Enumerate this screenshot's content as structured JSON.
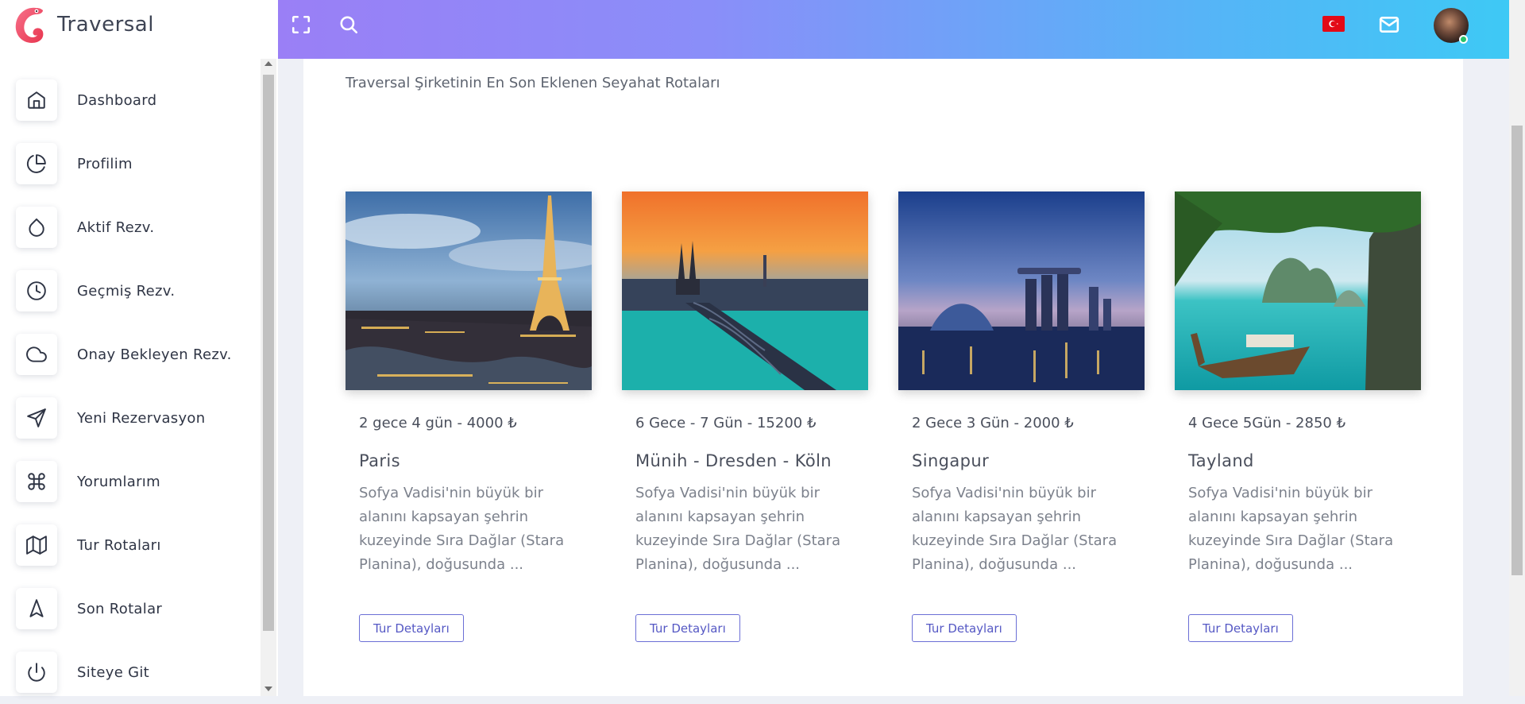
{
  "app": {
    "logo_text": "Traversal"
  },
  "sidebar": {
    "items": [
      {
        "label": "Dashboard",
        "icon": "home-icon"
      },
      {
        "label": "Profilim",
        "icon": "pie-chart-icon"
      },
      {
        "label": "Aktif Rezv.",
        "icon": "droplet-icon"
      },
      {
        "label": "Geçmiş Rezv.",
        "icon": "clock-icon"
      },
      {
        "label": "Onay Bekleyen Rezv.",
        "icon": "cloud-icon"
      },
      {
        "label": "Yeni Rezervasyon",
        "icon": "send-icon"
      },
      {
        "label": "Yorumlarım",
        "icon": "command-icon"
      },
      {
        "label": "Tur Rotaları",
        "icon": "map-icon"
      },
      {
        "label": "Son Rotalar",
        "icon": "navigation-icon"
      },
      {
        "label": "Siteye Git",
        "icon": "power-icon"
      }
    ]
  },
  "topbar": {
    "icons": [
      "fullscreen-icon",
      "search-icon",
      "turkey-flag-icon",
      "mail-icon",
      "user-avatar"
    ]
  },
  "main": {
    "subtitle": "Traversal Şirketinin En Son Eklenen Seyahat Rotaları",
    "tours": [
      {
        "meta": "2 gece 4 gün - 4000 ₺",
        "title": "Paris",
        "description": "Sofya Vadisi'nin büyük bir alanını kapsayan şehrin kuzeyinde Sıra Dağlar (Stara Planina), doğusunda ...",
        "button": "Tur Detayları"
      },
      {
        "meta": "6 Gece - 7 Gün - 15200 ₺",
        "title": "Münih - Dresden - Köln",
        "description": "Sofya Vadisi'nin büyük bir alanını kapsayan şehrin kuzeyinde Sıra Dağlar (Stara Planina), doğusunda ...",
        "button": "Tur Detayları"
      },
      {
        "meta": "2 Gece 3 Gün - 2000 ₺",
        "title": "Singapur",
        "description": "Sofya Vadisi'nin büyük bir alanını kapsayan şehrin kuzeyinde Sıra Dağlar (Stara Planina), doğusunda ...",
        "button": "Tur Detayları"
      },
      {
        "meta": "4 Gece 5Gün - 2850 ₺",
        "title": "Tayland",
        "description": "Sofya Vadisi'nin büyük bir alanını kapsayan şehrin kuzeyinde Sıra Dağlar (Stara Planina), doğusunda ...",
        "button": "Tur Detayları"
      }
    ]
  },
  "colors": {
    "topbar_gradient_start": "#9a7ff6",
    "topbar_gradient_end": "#3ec9f5",
    "button_accent": "#6b6fd6",
    "logo_accent": "#f0506e"
  }
}
